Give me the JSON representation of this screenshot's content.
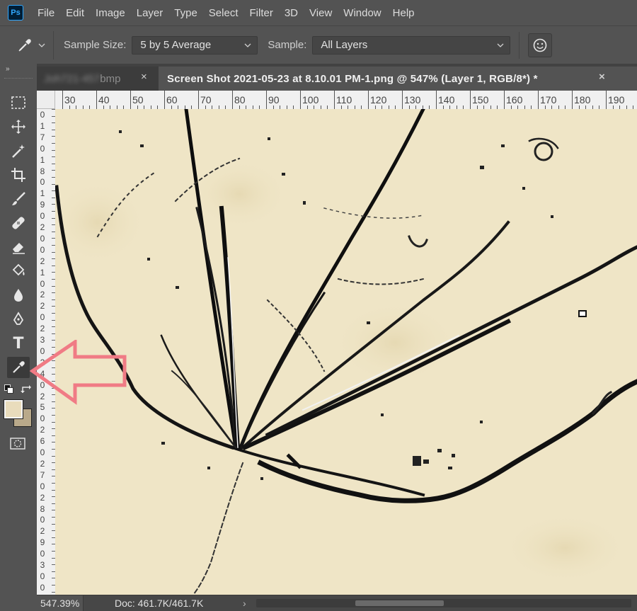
{
  "app": {
    "logo_text": "Ps"
  },
  "menu": [
    "File",
    "Edit",
    "Image",
    "Layer",
    "Type",
    "Select",
    "Filter",
    "3D",
    "View",
    "Window",
    "Help"
  ],
  "options": {
    "tool_icon": "eyedropper-icon",
    "sample_size_label": "Sample Size:",
    "sample_size_value": "5 by 5 Average",
    "sample_label": "Sample:",
    "sample_value": "All Layers",
    "target_icon": "show-sampling-ring-icon"
  },
  "tabs": [
    {
      "title": "bmp",
      "blurred_prefix": "Joh721-457",
      "active": false
    },
    {
      "title": "Screen Shot 2021-05-23 at 8.10.01 PM-1.png @ 547% (Layer 1, RGB/8*) *",
      "active": true
    }
  ],
  "ruler_top_labels": [
    "30",
    "40",
    "50",
    "60",
    "70",
    "80",
    "90",
    "100",
    "110",
    "120",
    "130",
    "140",
    "150",
    "160",
    "170",
    "180",
    "190"
  ],
  "ruler_left_labels": [
    "0",
    "1",
    "7",
    "0",
    "1",
    "8",
    "0",
    "1",
    "9",
    "0",
    "2",
    "0",
    "0",
    "2",
    "1",
    "0",
    "2",
    "2",
    "0",
    "2",
    "3",
    "0",
    "2",
    "4",
    "0",
    "2",
    "5",
    "0",
    "2",
    "6",
    "0",
    "2",
    "7",
    "0",
    "2",
    "8",
    "0",
    "2",
    "9",
    "0",
    "3",
    "0",
    "0"
  ],
  "tools": [
    {
      "name": "marquee-tool",
      "icon": "rectangle-marquee-icon"
    },
    {
      "name": "move-tool",
      "icon": "move-icon"
    },
    {
      "name": "magic-wand-tool",
      "icon": "magic-wand-icon"
    },
    {
      "name": "crop-tool",
      "icon": "crop-icon"
    },
    {
      "name": "brush-tool",
      "icon": "brush-icon"
    },
    {
      "name": "healing-tool",
      "icon": "bandage-icon"
    },
    {
      "name": "eraser-tool",
      "icon": "eraser-icon"
    },
    {
      "name": "paint-bucket-tool",
      "icon": "paint-bucket-icon"
    },
    {
      "name": "blur-tool",
      "icon": "drop-icon"
    },
    {
      "name": "pen-tool",
      "icon": "pen-icon"
    },
    {
      "name": "type-tool",
      "icon": "type-icon",
      "glyph": "T"
    },
    {
      "name": "eyedropper-tool",
      "icon": "eyedropper-icon",
      "active": true
    }
  ],
  "colors": {
    "foreground": "#e9dcbc",
    "background": "#b9a98a",
    "canvas": "#efe5c6",
    "annotation": "#f07b85"
  },
  "status": {
    "zoom": "547.39%",
    "doc": "Doc: 461.7K/461.7K",
    "arrow": "›"
  }
}
